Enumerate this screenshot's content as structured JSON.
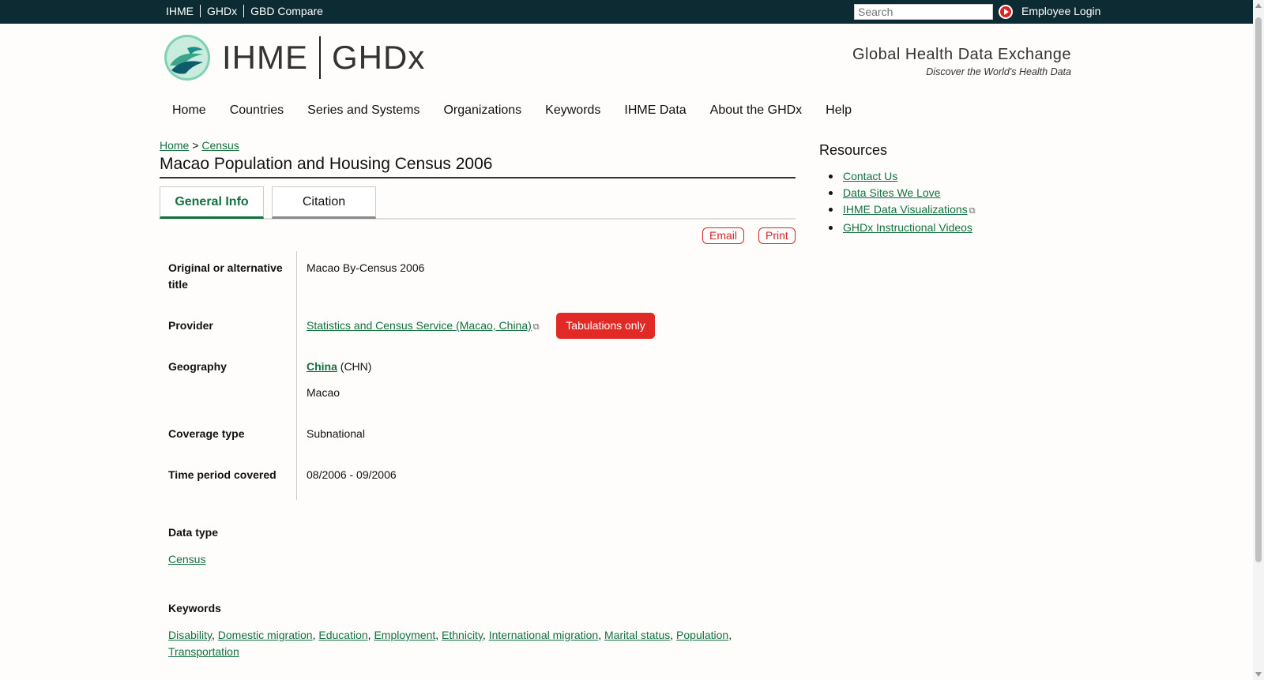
{
  "topbar": {
    "links": [
      "IHME",
      "GHDx",
      "GBD Compare"
    ],
    "search_placeholder": "Search",
    "login": "Employee Login"
  },
  "brand": {
    "name1": "IHME",
    "name2": "GHDx",
    "tagline1": "Global Health Data Exchange",
    "tagline2": "Discover the World's Health Data"
  },
  "nav": [
    "Home",
    "Countries",
    "Series and Systems",
    "Organizations",
    "Keywords",
    "IHME Data",
    "About the GHDx",
    "Help"
  ],
  "breadcrumb": {
    "home": "Home",
    "sep": ">",
    "current": "Census"
  },
  "page_title": "Macao Population and Housing Census 2006",
  "tabs": {
    "general": "General Info",
    "citation": "Citation"
  },
  "actions": {
    "email": "Email",
    "print": "Print"
  },
  "details": {
    "alt_title_label": "Original or alternative title",
    "alt_title_value": "Macao By-Census 2006",
    "provider_label": "Provider",
    "provider_value": "Statistics and Census Service (Macao, China)",
    "provider_badge": "Tabulations only",
    "geography_label": "Geography",
    "geography_country": "China",
    "geography_code": "(CHN)",
    "geography_region": "Macao",
    "coverage_label": "Coverage type",
    "coverage_value": "Subnational",
    "time_label": "Time period covered",
    "time_value": "08/2006 - 09/2006"
  },
  "data_type": {
    "label": "Data type",
    "value": "Census"
  },
  "keywords": {
    "label": "Keywords",
    "items": [
      "Disability",
      "Domestic migration",
      "Education",
      "Employment",
      "Ethnicity",
      "International migration",
      "Marital status",
      "Population",
      "Transportation"
    ]
  },
  "resources": {
    "heading": "Resources",
    "items": [
      "Contact Us",
      "Data Sites We Love",
      "IHME Data Visualizations",
      "GHDx Instructional Videos"
    ]
  },
  "colors": {
    "topbar": "#0c2b33",
    "link": "#12703f",
    "badge": "#e12a26"
  }
}
